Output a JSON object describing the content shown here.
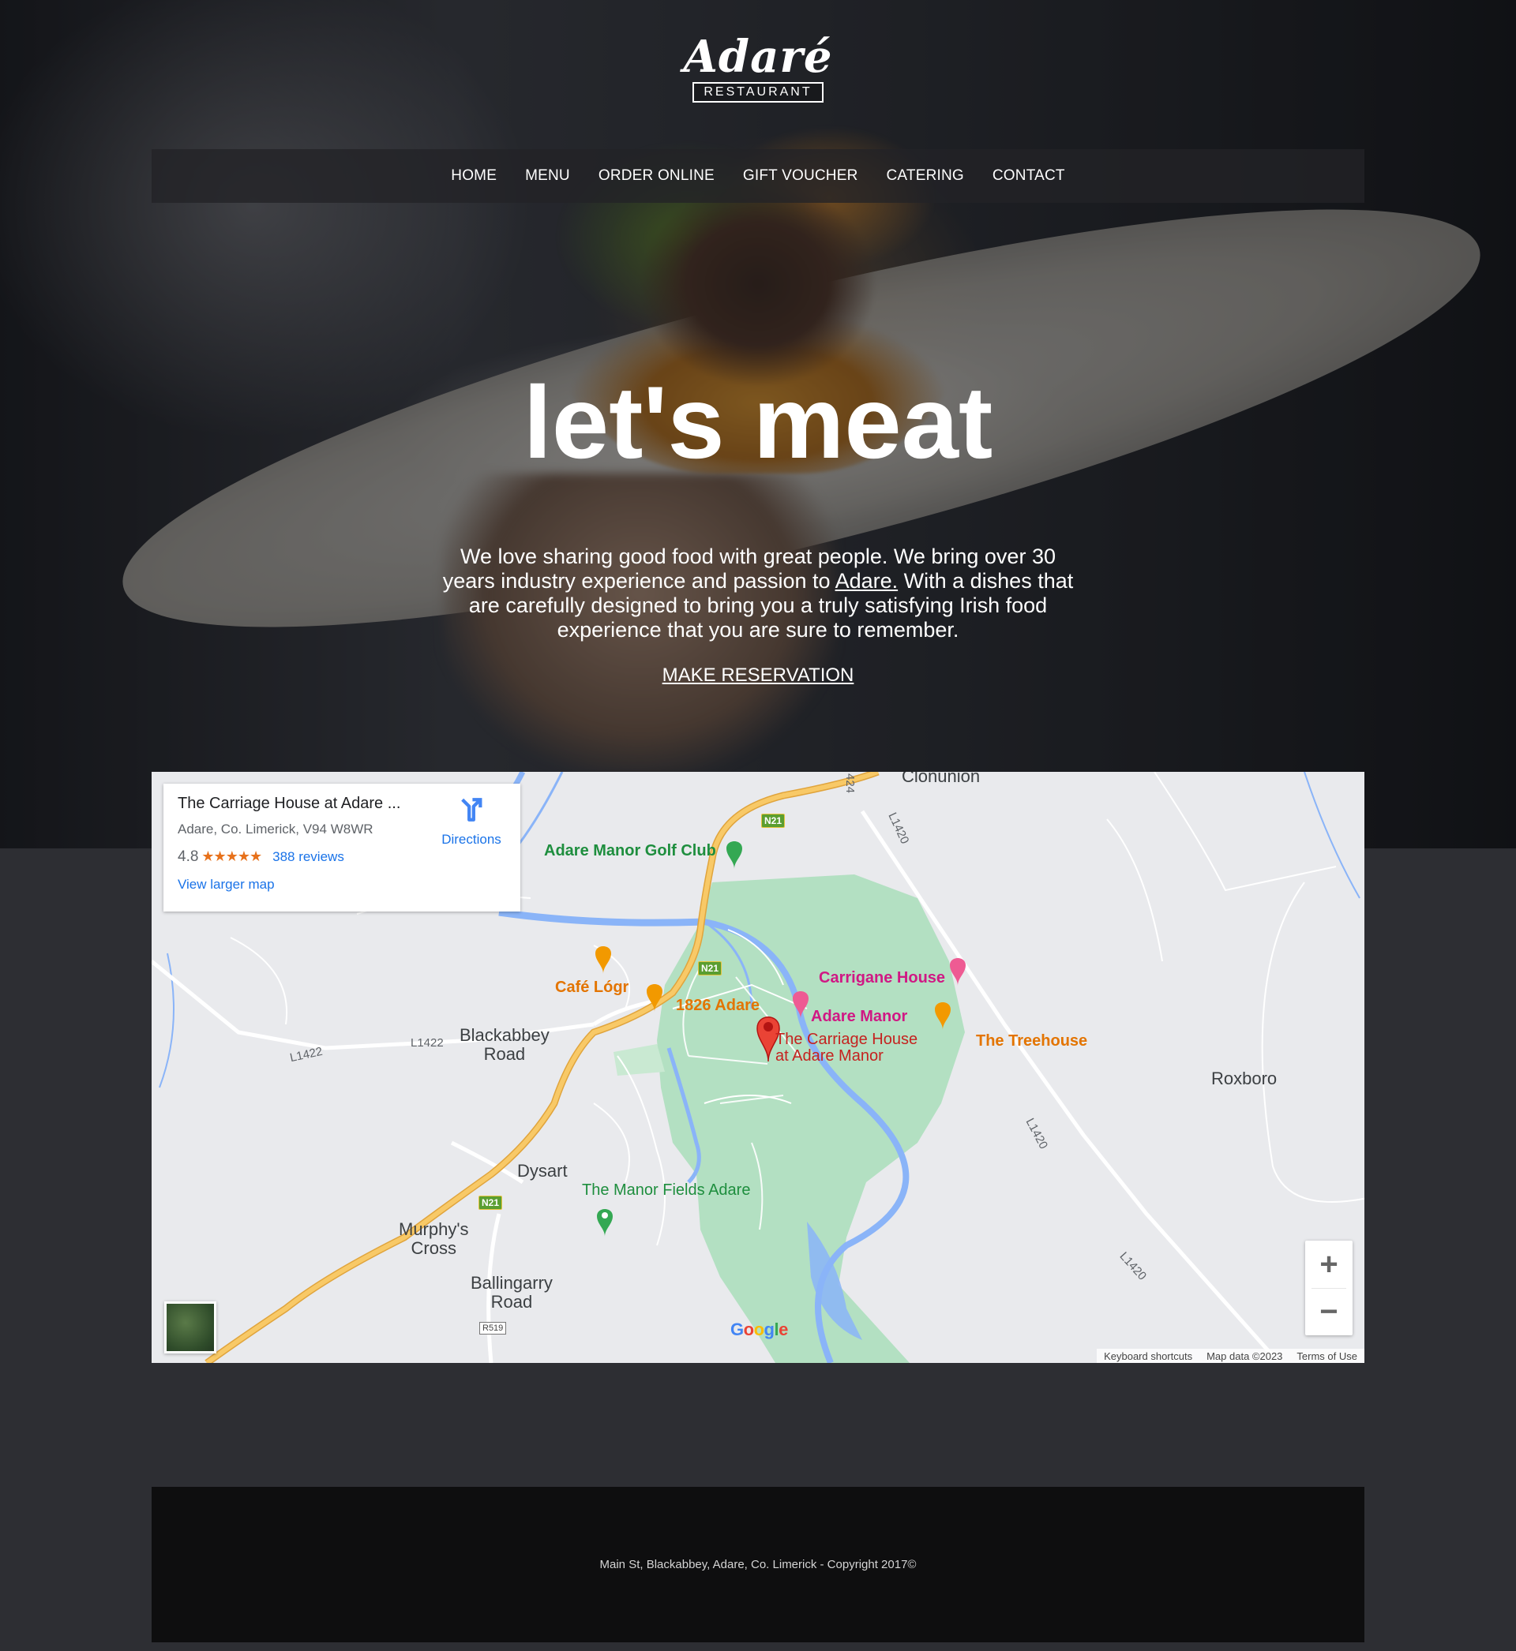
{
  "brand": {
    "logo_word": "Adaré",
    "logo_sub": "RESTAURANT"
  },
  "nav": {
    "items": [
      "HOME",
      "MENU",
      "ORDER ONLINE",
      "GIFT VOUCHER",
      "CATERING",
      "CONTACT"
    ]
  },
  "hero": {
    "headline": "let's meat",
    "intro_part1": "We love sharing good food with great people. We bring over 30 years industry experience and passion to ",
    "intro_link": "Adare.",
    "intro_part2": " With a dishes that are carefully designed to bring you a truly satisfying Irish food experience that you are sure to remember.",
    "cta": "MAKE RESERVATION"
  },
  "map": {
    "card": {
      "title": "The Carriage House at Adare ...",
      "address": "Adare, Co. Limerick, V94 W8WR",
      "rating": "4.8",
      "stars": "★★★★★",
      "reviews": "388 reviews",
      "larger_map": "View larger map",
      "directions": "Directions"
    },
    "places": {
      "clonunion": "Clonunion",
      "golf": "Adare Manor Golf Club",
      "carrigane": "Carrigane House",
      "cafe_logr": "Café Lógr",
      "adare_1826": "1826 Adare",
      "adare_manor": "Adare Manor",
      "carriage_house_l1": "The Carriage House",
      "carriage_house_l2": "at Adare Manor",
      "treehouse": "The Treehouse",
      "blackabbey_l1": "Blackabbey",
      "blackabbey_l2": "Road",
      "roxboro": "Roxboro",
      "dysart": "Dysart",
      "manor_fields": "The Manor Fields Adare",
      "murphys_l1": "Murphy's",
      "murphys_l2": "Cross",
      "ballingarry_l1": "Ballingarry",
      "ballingarry_l2": "Road"
    },
    "roads": {
      "n21": "N21",
      "l1420": "L1420",
      "l1422": "L1422",
      "r519": "R519",
      "r424": "424"
    },
    "google": "Google",
    "attribution": [
      "Keyboard shortcuts",
      "Map data ©2023",
      "Terms of Use"
    ],
    "zoom_in": "+",
    "zoom_out": "−"
  },
  "footer": {
    "text": "Main St, Blackabbey, Adare, Co. Limerick - Copyright 2017©"
  },
  "colors": {
    "page_bg": "#2d2e33",
    "footer_bg": "#0e0e0f",
    "link_blue": "#1a73e8",
    "park_green": "#b3e0c2",
    "water": "#8ab4f8",
    "road_yellow": "#f8c967"
  }
}
